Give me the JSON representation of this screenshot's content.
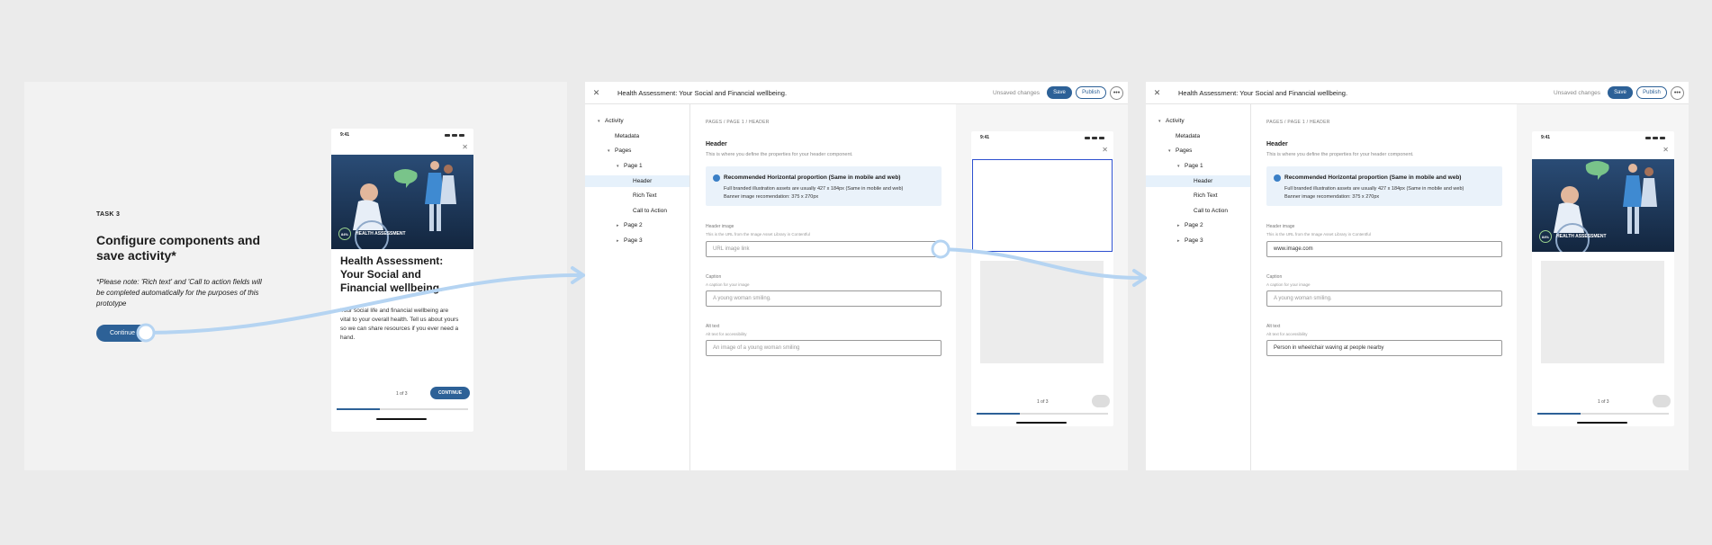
{
  "task": {
    "label": "TASK 3",
    "title": "Configure components and save activity*",
    "note": "*Please note: 'Rich text' and 'Call to action fields will be completed automatically for the purposes of this prototype",
    "continue_label": "Continue"
  },
  "mobile_intro": {
    "time": "9:41",
    "close_icon": "✕",
    "badge_percent": "84%",
    "badge_label": "HEALTH ASSESSMENT",
    "title": "Health Assessment: Your Social and Financial wellbeing.",
    "body": "Your social life and financial wellbeing are vital to your overall health. Tell us about yours so we can share resources if you ever need a hand.",
    "pager": "1 of 3",
    "continue_label": "CONTINUE"
  },
  "editor": {
    "close_icon": "✕",
    "title": "Health Assessment: Your Social and Financial wellbeing.",
    "unsaved": "Unsaved changes",
    "save_label": "Save",
    "publish_label": "Publish",
    "more_icon": "•••",
    "tree": {
      "activity": "Activity",
      "metadata": "Metadata",
      "pages": "Pages",
      "page1": "Page 1",
      "header": "Header",
      "rich_text": "Rich Text",
      "cta": "Call to Action",
      "page2": "Page 2",
      "page3": "Page 3"
    },
    "breadcrumb": "PAGES / PAGE 1 / HEADER",
    "section_title": "Header",
    "section_desc": "This is where you define the properties for your header component.",
    "info_title": "Recommended Horizontal proportion (Same in mobile and web)",
    "info_items": [
      "Full branded illustration assets are usually 427 x 184px (Same in mobile and web)",
      "Banner image recomendation: 375 x 270px"
    ],
    "header_image_label": "Header image",
    "header_image_help": "This is the URL from the Image Asset Library in Contentful",
    "header_image_placeholder": "URL image link",
    "header_image_value": "www.image.com",
    "caption_label": "Caption",
    "caption_help": "A caption for your image",
    "caption_placeholder": "A young woman smiling.",
    "alt_label": "Alt text",
    "alt_help": "Alt text for accessibility",
    "alt_placeholder": "An image of a young woman smiling",
    "alt_value": "Person in wheelchair waving at people nearby",
    "preview": {
      "time": "9:41",
      "badge_percent": "84%",
      "badge_label": "HEALTH ASSESSMENT",
      "pager": "1 of 3"
    }
  },
  "colors": {
    "primary": "#2d6197",
    "connector": "#b5d4f2",
    "hero": "#1d3a5e",
    "info_bg": "#eaf2fa"
  }
}
